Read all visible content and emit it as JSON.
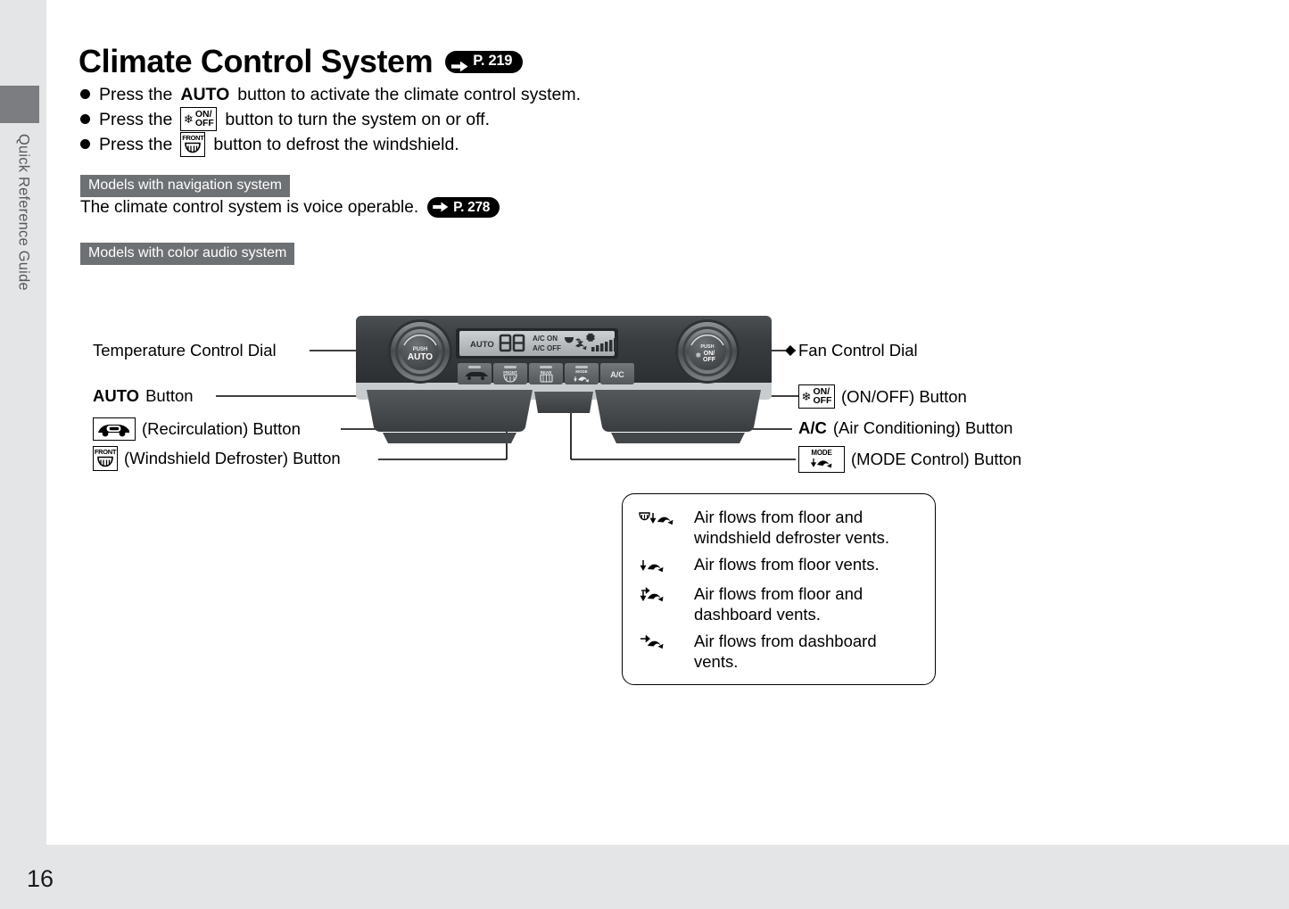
{
  "sidebar": {
    "section_label": "Quick Reference Guide"
  },
  "footer": {
    "page_number": "16"
  },
  "header": {
    "title": "Climate Control System",
    "page_ref": "P. 219"
  },
  "bullets": [
    {
      "pre": "Press the",
      "bold": "AUTO",
      "post": "button to activate the climate control system.",
      "icon": ""
    },
    {
      "pre": "Press the",
      "bold": "",
      "post": "button to turn the system on or off.",
      "icon": "fan-onoff-icon"
    },
    {
      "pre": "Press the",
      "bold": "",
      "post": "button to defrost the windshield.",
      "icon": "front-defroster-icon"
    }
  ],
  "notes": {
    "nav_banner": "Models with navigation system",
    "nav_text": "The climate control system is voice operable.",
    "nav_page_ref": "P. 278",
    "audio_banner": "Models with color audio system"
  },
  "panel": {
    "left_dial_top": "PUSH",
    "left_dial_main": "AUTO",
    "right_dial_top": "PUSH",
    "right_dial_on": "ON/",
    "right_dial_off": "OFF",
    "lcd": {
      "auto": "AUTO",
      "digits": "88",
      "ac_on": "A/C ON",
      "ac_off": "A/C OFF"
    },
    "buttons": [
      {
        "name": "recirculation-button",
        "caption": ""
      },
      {
        "name": "front-defroster-button",
        "caption": "FRONT"
      },
      {
        "name": "rear-defogger-button",
        "caption": "REAR"
      },
      {
        "name": "mode-button",
        "caption": "MODE"
      },
      {
        "name": "ac-button",
        "caption": "A/C"
      }
    ]
  },
  "callouts": {
    "temperature_dial": "Temperature Control Dial",
    "auto_button_bold": "AUTO",
    "auto_button_rest": "Button",
    "recirculation": "(Recirculation) Button",
    "windshield_defroster": "(Windshield Defroster) Button",
    "fan_dial": "Fan Control Dial",
    "onoff_button": "(ON/OFF) Button",
    "ac_button_bold": "A/C",
    "ac_button_rest": "(Air Conditioning) Button",
    "mode_button": "(MODE Control) Button"
  },
  "legend": [
    {
      "icon": "defrost-floor-airflow-icon",
      "text": "Air flows from floor and windshield defroster vents."
    },
    {
      "icon": "floor-airflow-icon",
      "text": "Air flows from floor vents."
    },
    {
      "icon": "floor-dash-airflow-icon",
      "text": "Air flows from floor and dashboard vents."
    },
    {
      "icon": "dash-airflow-icon",
      "text": "Air flows from dashboard vents."
    }
  ],
  "colors": {
    "sidebar_bg": "#e3e5e7",
    "tab_gray": "#7b7d80",
    "banner_gray": "#6e7174",
    "ink": "#000000"
  }
}
